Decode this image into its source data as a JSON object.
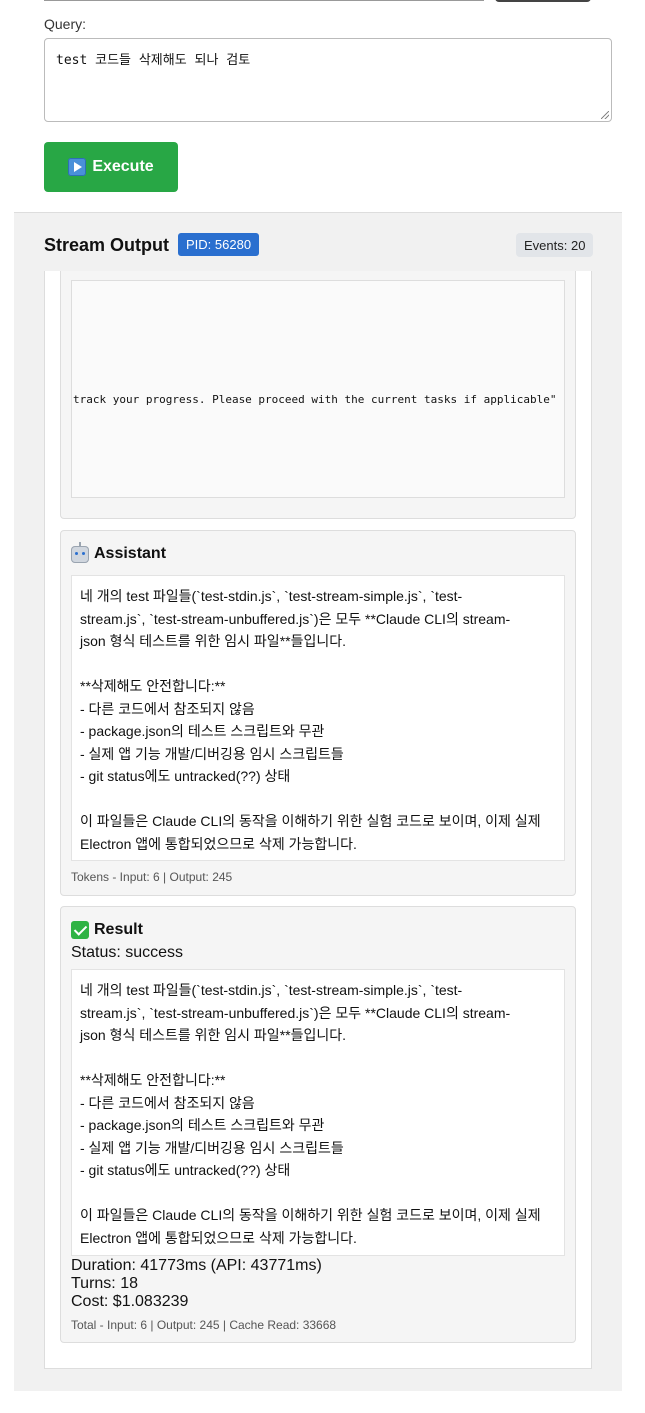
{
  "query": {
    "label": "Query:",
    "value": "test 코드들 삭제해도 되나 검토"
  },
  "execute_button": {
    "label": "Execute",
    "icon": "play-icon"
  },
  "stream": {
    "title": "Stream Output",
    "pid": "PID: 56280",
    "events": "Events: 20"
  },
  "tool_output": {
    "text": "track your progress. Please proceed with the current tasks if applicable\""
  },
  "assistant": {
    "title": "Assistant",
    "icon": "robot-icon",
    "lines": [
      "네 개의 test 파일들(`test-stdin.js`, `test-stream-simple.js`, `test-",
      "stream.js`, `test-stream-unbuffered.js`)은 모두 **Claude CLI의 stream-",
      "json 형식 테스트를 위한 임시 파일**들입니다.",
      "",
      "**삭제해도 안전합니다:**",
      "- 다른 코드에서 참조되지 않음",
      "- package.json의 테스트 스크립트와 무관",
      "- 실제 앱 기능 개발/디버깅용 임시 스크립트들",
      "- git status에도 untracked(??) 상태",
      "",
      "이 파일들은 Claude CLI의 동작을 이해하기 위한 실험 코드로 보이며, 이제 실제",
      "Electron 앱에 통합되었으므로 삭제 가능합니다."
    ],
    "tokens": "Tokens - Input: 6 | Output: 245"
  },
  "result": {
    "title": "Result",
    "icon": "check-icon",
    "status": "Status: success",
    "lines": [
      "네 개의 test 파일들(`test-stdin.js`, `test-stream-simple.js`, `test-",
      "stream.js`, `test-stream-unbuffered.js`)은 모두 **Claude CLI의 stream-",
      "json 형식 테스트를 위한 임시 파일**들입니다.",
      "",
      "**삭제해도 안전합니다:**",
      "- 다른 코드에서 참조되지 않음",
      "- package.json의 테스트 스크립트와 무관",
      "- 실제 앱 기능 개발/디버깅용 임시 스크립트들",
      "- git status에도 untracked(??) 상태",
      "",
      "이 파일들은 Claude CLI의 동작을 이해하기 위한 실험 코드로 보이며, 이제 실제",
      "Electron 앱에 통합되었으므로 삭제 가능합니다."
    ],
    "duration": "Duration: 41773ms (API: 43771ms)",
    "turns": "Turns: 18",
    "cost": "Cost: $1.083239",
    "totals": "Total - Input: 6 | Output: 245 | Cache Read: 33668"
  }
}
